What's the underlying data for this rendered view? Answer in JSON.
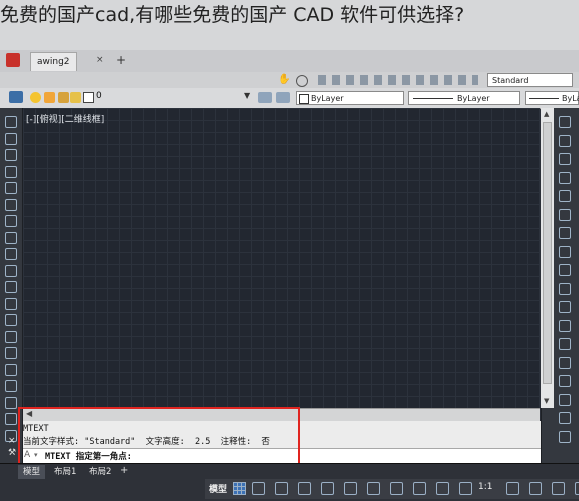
{
  "page": {
    "title": "免费的国产cad,有哪些免费的国产 CAD 软件可供选择?"
  },
  "tabs": {
    "drawing_tab": "awing2",
    "add_tab": "+"
  },
  "properties": {
    "layer_value": "0",
    "color_value": "ByLayer",
    "linetype_value": "ByLayer",
    "lineweight_value": "ByLa",
    "style_value": "Standard"
  },
  "viewport": {
    "label": "[-][俯视][二维线框]"
  },
  "command": {
    "line1": "MTEXT",
    "line2": "当前文字样式: \"Standard\"  文字高度:  2.5  注释性:  否",
    "prompt": "MTEXT 指定第一角点:"
  },
  "layout_tabs": [
    "模型",
    "布局1",
    "布局2"
  ],
  "status": {
    "model_label": "模型",
    "scale": "1:1"
  },
  "colors": {
    "highlight": "#e0241f",
    "canvas_bg": "#222730",
    "ui_dark": "#34383f"
  }
}
